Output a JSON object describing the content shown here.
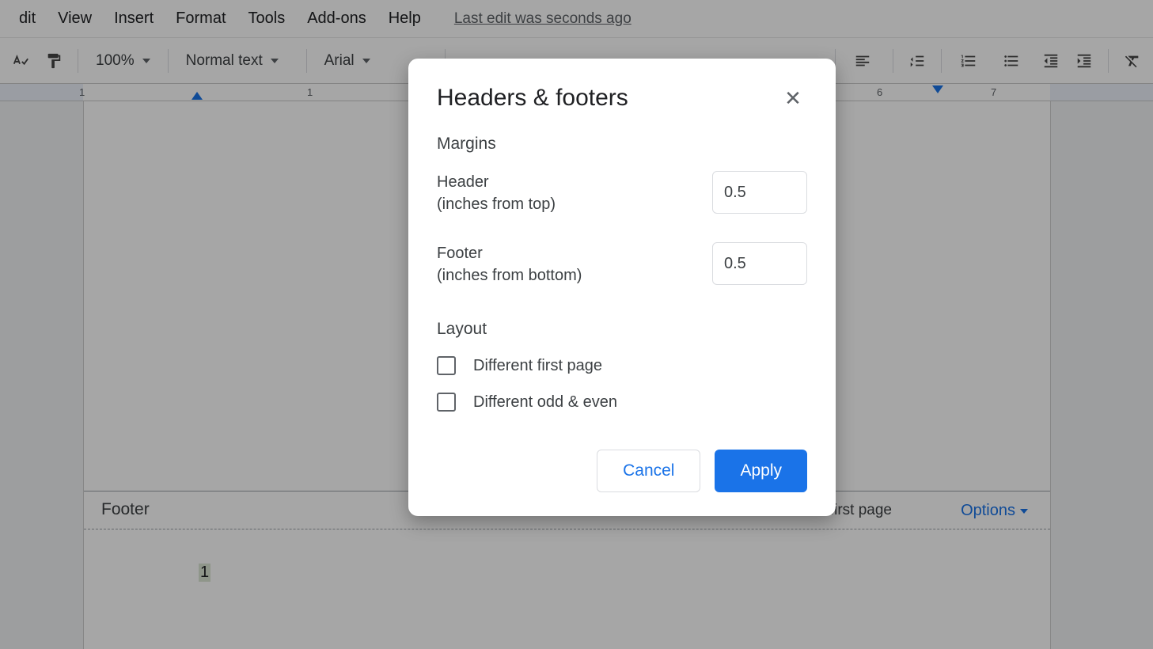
{
  "menubar": {
    "items": [
      "dit",
      "View",
      "Insert",
      "Format",
      "Tools",
      "Add-ons",
      "Help"
    ],
    "last_edit": "Last edit was seconds ago"
  },
  "toolbar": {
    "zoom": "100%",
    "style": "Normal text",
    "font": "Arial"
  },
  "ruler": {
    "numbers": [
      "1",
      "1",
      "6",
      "7"
    ]
  },
  "footer_area": {
    "label": "Footer",
    "different_first_page": "ferent first page",
    "options": "Options",
    "page_number": "1"
  },
  "dialog": {
    "title": "Headers & footers",
    "section_margins": "Margins",
    "header_label_line1": "Header",
    "header_label_line2": "(inches from top)",
    "header_value": "0.5",
    "footer_label_line1": "Footer",
    "footer_label_line2": "(inches from bottom)",
    "footer_value": "0.5",
    "section_layout": "Layout",
    "checkbox_first_page": "Different first page",
    "checkbox_odd_even": "Different odd & even",
    "cancel": "Cancel",
    "apply": "Apply"
  }
}
